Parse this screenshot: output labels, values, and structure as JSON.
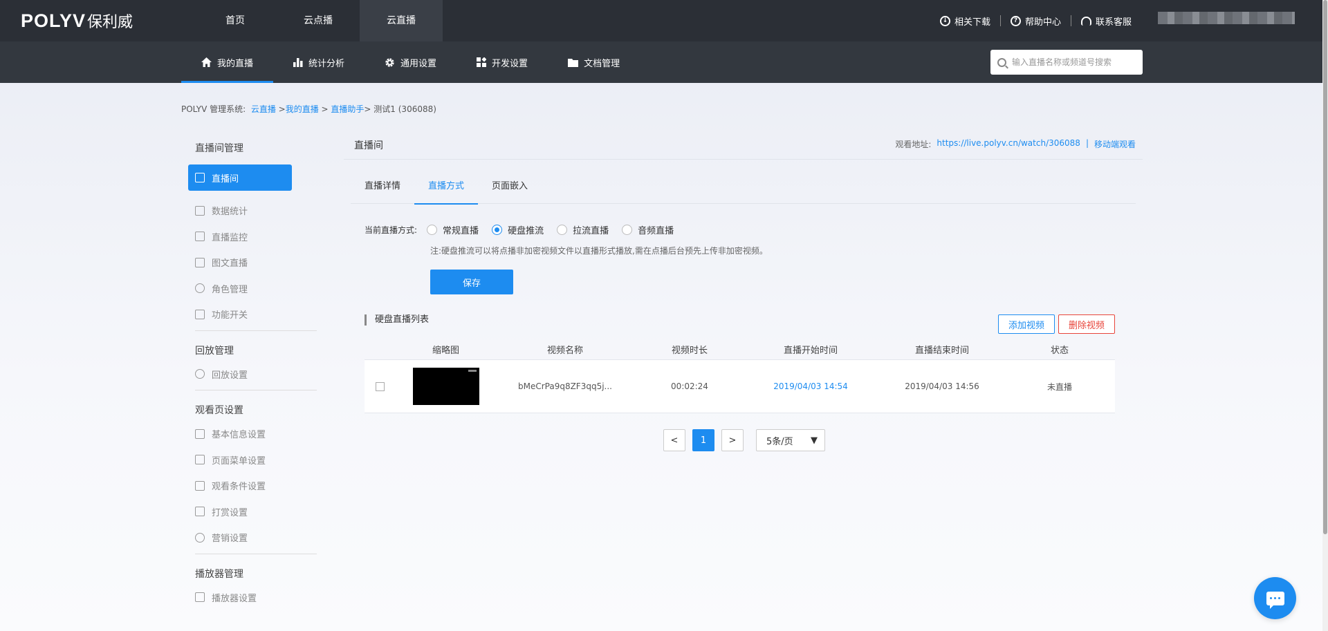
{
  "header": {
    "logo_latin": "POLYV",
    "logo_cn": "保利威",
    "nav": [
      {
        "label": "首页"
      },
      {
        "label": "云点播"
      },
      {
        "label": "云直播"
      }
    ],
    "links": [
      {
        "label": "相关下载",
        "icon": "download-icon"
      },
      {
        "label": "帮助中心",
        "icon": "help-icon"
      },
      {
        "label": "联系客服",
        "icon": "headset-icon"
      }
    ]
  },
  "subnav": {
    "items": [
      {
        "label": "我的直播",
        "icon": "home-icon"
      },
      {
        "label": "统计分析",
        "icon": "bar-chart-icon"
      },
      {
        "label": "通用设置",
        "icon": "gear-icon"
      },
      {
        "label": "开发设置",
        "icon": "grid-icon"
      },
      {
        "label": "文档管理",
        "icon": "folder-icon"
      }
    ],
    "search_placeholder": "输入直播名称或频道号搜索"
  },
  "breadcrumb": {
    "prefix": "POLYV 管理系统:",
    "items": [
      "云直播",
      "我的直播",
      "直播助手"
    ],
    "current": "测试1 (306088)"
  },
  "sidebar": {
    "group1": {
      "title": "直播间管理",
      "items": [
        "直播间",
        "数据统计",
        "直播监控",
        "图文直播",
        "角色管理",
        "功能开关"
      ]
    },
    "group2": {
      "title": "回放管理",
      "items": [
        "回放设置"
      ]
    },
    "group3": {
      "title": "观看页设置",
      "items": [
        "基本信息设置",
        "页面菜单设置",
        "观看条件设置",
        "打赏设置",
        "营销设置"
      ]
    },
    "group4": {
      "title": "播放器管理",
      "items": [
        "播放器设置"
      ]
    }
  },
  "panel": {
    "title": "直播间",
    "watch_label": "观看地址:",
    "watch_url": "https://live.polyv.cn/watch/306088",
    "mobile_link": "移动端观看",
    "tabs": [
      "直播详情",
      "直播方式",
      "页面嵌入"
    ],
    "mode_label": "当前直播方式:",
    "modes": [
      "常规直播",
      "硬盘推流",
      "拉流直播",
      "音频直播"
    ],
    "note": "注:硬盘推流可以将点播非加密视频文件以直播形式播放,需在点播后台预先上传非加密视频。",
    "save_label": "保存",
    "list_title": "硬盘直播列表",
    "add_label": "添加视频",
    "delete_label": "删除视频"
  },
  "table": {
    "headers": [
      "缩略图",
      "视频名称",
      "视频时长",
      "直播开始时间",
      "直播结束时间",
      "状态"
    ],
    "rows": [
      {
        "name": "bMeCrPa9q8ZF3qq5j...",
        "duration": "00:02:24",
        "start": "2019/04/03 14:54",
        "end": "2019/04/03 14:56",
        "status": "未直播"
      }
    ]
  },
  "pager": {
    "prev": "<",
    "current": "1",
    "next": ">",
    "page_size": "5条/页"
  },
  "colors": {
    "accent": "#1d8cf0",
    "danger": "#e8443a",
    "topbar": "#2b2f36",
    "subbar": "#33383f"
  }
}
